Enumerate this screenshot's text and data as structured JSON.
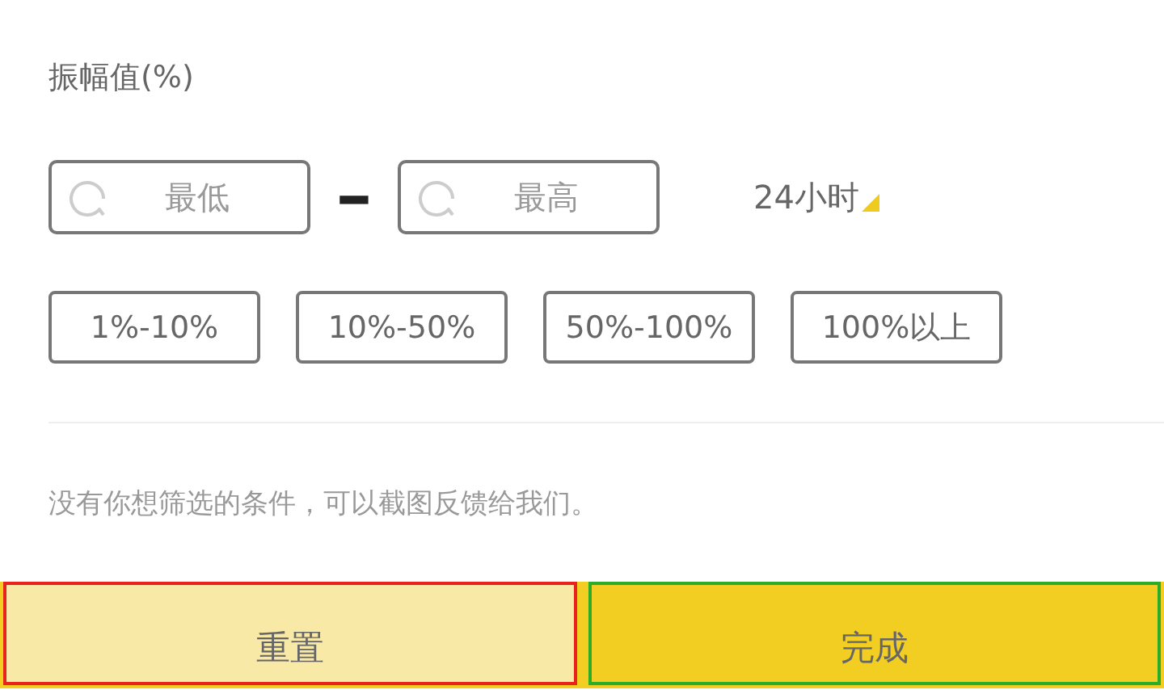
{
  "section": {
    "title": "振幅值(%)"
  },
  "range": {
    "min": {
      "placeholder": "最低"
    },
    "separator": "-",
    "max": {
      "placeholder": "最高"
    },
    "period": "24小时"
  },
  "presets": [
    "1%-10%",
    "10%-50%",
    "50%-100%",
    "100%以上"
  ],
  "note": "没有你想筛选的条件，可以截图反馈给我们。",
  "buttons": [
    {
      "label": "重置",
      "kind": "reset"
    },
    {
      "label": "完成",
      "kind": "done"
    }
  ]
}
